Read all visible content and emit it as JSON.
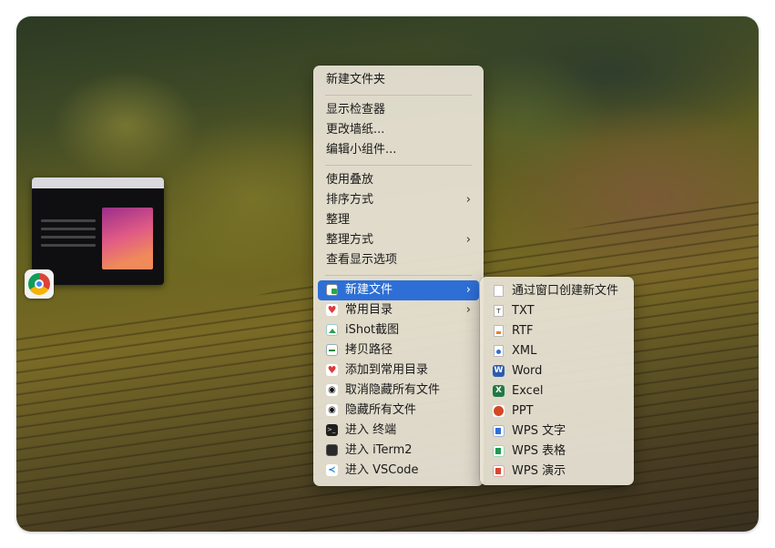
{
  "context_menu": {
    "groups": [
      [
        {
          "label": "新建文件夹"
        }
      ],
      [
        {
          "label": "显示检查器"
        },
        {
          "label": "更改墙纸..."
        },
        {
          "label": "编辑小组件..."
        }
      ],
      [
        {
          "label": "使用叠放"
        },
        {
          "label": "排序方式",
          "submenu": true
        },
        {
          "label": "整理"
        },
        {
          "label": "整理方式",
          "submenu": true
        },
        {
          "label": "查看显示选项"
        }
      ]
    ],
    "tool_items": [
      {
        "label": "新建文件",
        "icon": "new-file-icon",
        "submenu": true,
        "highlighted": true
      },
      {
        "label": "常用目录",
        "icon": "heart-icon",
        "submenu": true
      },
      {
        "label": "iShot截图",
        "icon": "image-icon"
      },
      {
        "label": "拷贝路径",
        "icon": "copy-path-icon"
      },
      {
        "label": "添加到常用目录",
        "icon": "heart-icon"
      },
      {
        "label": "取消隐藏所有文件",
        "icon": "eye-icon"
      },
      {
        "label": "隐藏所有文件",
        "icon": "eye-icon"
      },
      {
        "label": "进入 终端",
        "icon": "terminal-icon"
      },
      {
        "label": "进入 iTerm2",
        "icon": "iterm-icon"
      },
      {
        "label": "进入 VSCode",
        "icon": "vscode-icon"
      }
    ]
  },
  "new_file_submenu": {
    "items": [
      {
        "label": "通过窗口创建新文件",
        "icon": "document-icon"
      },
      {
        "label": "TXT",
        "icon": "txt-icon"
      },
      {
        "label": "RTF",
        "icon": "rtf-icon"
      },
      {
        "label": "XML",
        "icon": "xml-icon"
      },
      {
        "label": "Word",
        "icon": "word-icon"
      },
      {
        "label": "Excel",
        "icon": "excel-icon"
      },
      {
        "label": "PPT",
        "icon": "ppt-icon"
      },
      {
        "label": "WPS 文字",
        "icon": "wps-writer-icon"
      },
      {
        "label": "WPS 表格",
        "icon": "wps-spreadsheet-icon"
      },
      {
        "label": "WPS 演示",
        "icon": "wps-presentation-icon"
      }
    ]
  },
  "icons": {
    "chevron": "›",
    "heart": "♥",
    "eye": "◉",
    "word": "W",
    "excel": "X",
    "vscode": "≺",
    "term": ">_",
    "txt": "T"
  },
  "colors": {
    "highlight": "#2d6fd6"
  }
}
